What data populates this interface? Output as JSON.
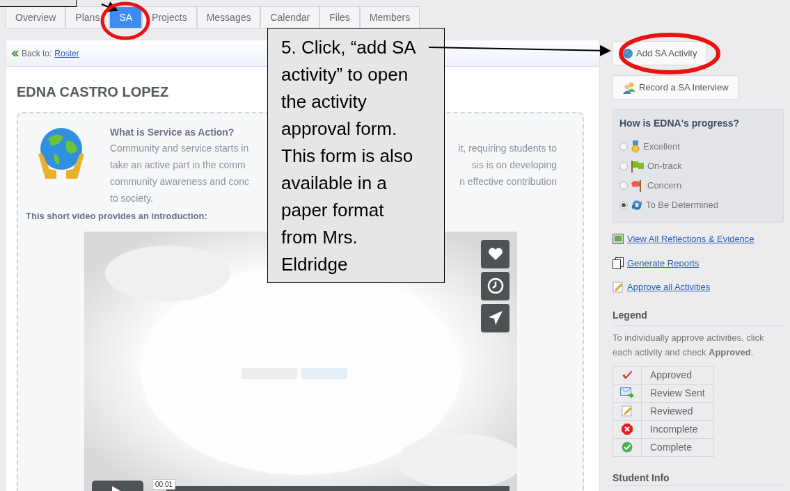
{
  "callout": {
    "text": "5. Click, “add SA activity” to open the activity approval form. This form is also available in a paper format from Mrs. Eldridge"
  },
  "tabs": [
    {
      "label": "Overview",
      "selected": false
    },
    {
      "label": "Plans",
      "selected": false
    },
    {
      "label": "SA",
      "selected": true
    },
    {
      "label": "Projects",
      "selected": false
    },
    {
      "label": "Messages",
      "selected": false
    },
    {
      "label": "Calendar",
      "selected": false
    },
    {
      "label": "Files",
      "selected": false
    },
    {
      "label": "Members",
      "selected": false
    }
  ],
  "breadcrumb": {
    "label": "Back to:",
    "link": "Roster"
  },
  "student_name": "EDNA CASTRO LOPEZ",
  "intro": {
    "title": "What is Service as Action?",
    "lines": [
      {
        "left": "Community and service starts in",
        "right": "it, requiring students to"
      },
      {
        "left": "take an active part in the comm",
        "right": "sis is on developing"
      },
      {
        "left": "community awareness and conc",
        "right": "n effective contribution"
      },
      {
        "left": "to society."
      }
    ],
    "video_caption": "This short video provides an introduction:"
  },
  "video": {
    "kind": "picture",
    "timestamp": "00:01"
  },
  "sidebar": {
    "buttons": [
      {
        "kind": "add",
        "label": "Add SA Activity"
      },
      {
        "kind": "interview",
        "label": "Record a SA Interview"
      }
    ],
    "progress": {
      "title": "How is EDNA's progress?",
      "options": [
        {
          "kind": "excellent",
          "label": "Excellent",
          "selected": false
        },
        {
          "kind": "on_track",
          "label": "On-track",
          "selected": false
        },
        {
          "kind": "concern",
          "label": "Concern",
          "selected": false
        },
        {
          "kind": "tbd",
          "label": "To Be Determined",
          "selected": true
        }
      ]
    },
    "links": [
      {
        "kind": "reflections",
        "label": "View All Reflections & Evidence"
      },
      {
        "kind": "reports",
        "label": "Generate Reports"
      },
      {
        "kind": "approve",
        "label": "Approve all Activities"
      }
    ],
    "legend": {
      "title": "Legend",
      "note": "To individually approve activities, click each activity and check **Approved**.",
      "rows": [
        {
          "kind": "approved",
          "label": "Approved"
        },
        {
          "kind": "review_sent",
          "label": "Review Sent"
        },
        {
          "kind": "reviewed",
          "label": "Reviewed"
        },
        {
          "kind": "incomplete",
          "label": "Incomplete"
        },
        {
          "kind": "complete",
          "label": "Complete"
        }
      ]
    },
    "student_info": "Student Info"
  }
}
